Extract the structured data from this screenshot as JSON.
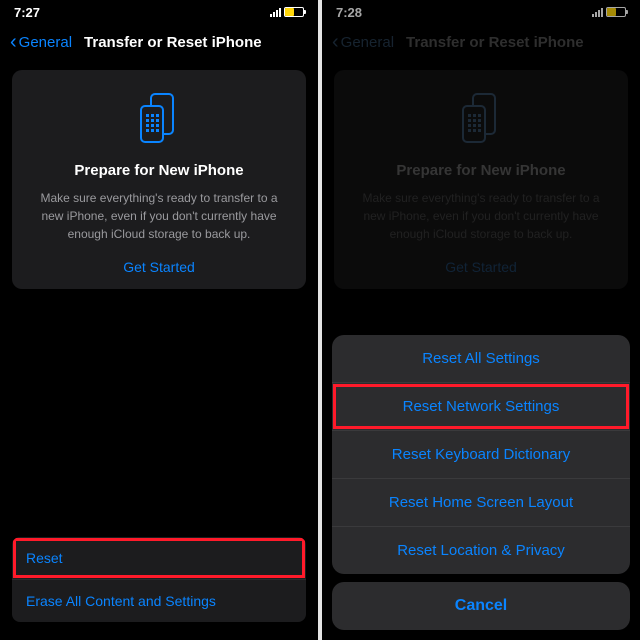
{
  "left": {
    "time": "7:27",
    "back_label": "General",
    "page_title": "Transfer or Reset iPhone",
    "card": {
      "title": "Prepare for New iPhone",
      "body": "Make sure everything's ready to transfer to a new iPhone, even if you don't currently have enough iCloud storage to back up.",
      "action": "Get Started"
    },
    "rows": {
      "reset": "Reset",
      "erase": "Erase All Content and Settings"
    }
  },
  "right": {
    "time": "7:28",
    "back_label": "General",
    "page_title": "Transfer or Reset iPhone",
    "card": {
      "title": "Prepare for New iPhone",
      "body": "Make sure everything's ready to transfer to a new iPhone, even if you don't currently have enough iCloud storage to back up.",
      "action": "Get Started"
    },
    "sheet": {
      "opt1": "Reset All Settings",
      "opt2": "Reset Network Settings",
      "opt3": "Reset Keyboard Dictionary",
      "opt4": "Reset Home Screen Layout",
      "opt5": "Reset Location & Privacy",
      "cancel": "Cancel"
    }
  }
}
